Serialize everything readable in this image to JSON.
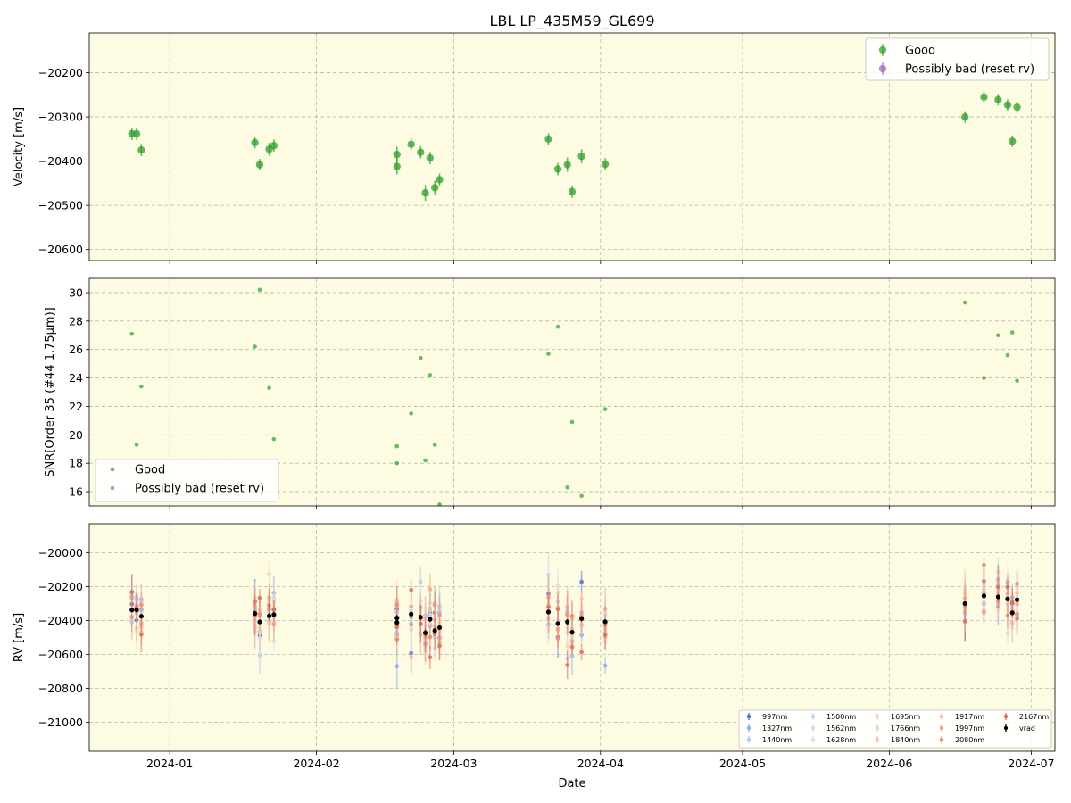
{
  "chart_data": [
    {
      "type": "scatter",
      "panel": "velocity",
      "title": "LBL LP_435M59_GL699",
      "xlabel": "",
      "ylabel": "Velocity [m/s]",
      "ylim": [
        -20625,
        -20110
      ],
      "yticks": [
        -20200,
        -20300,
        -20400,
        -20500,
        -20600
      ],
      "ytick_labels": [
        "−20200",
        "−20300",
        "−20400",
        "−20500",
        "−20600"
      ],
      "grid": true,
      "legend": "top-right",
      "legend_entries": [
        {
          "label": "Good",
          "color": "#2ca02c"
        },
        {
          "label": "Possibly bad (reset rv)",
          "color": "#9467bd"
        }
      ],
      "series": [
        {
          "name": "Good",
          "color": "#2ca02c",
          "x": [
            "2023-12-24",
            "2023-12-25",
            "2023-12-26",
            "2024-01-19",
            "2024-01-20",
            "2024-01-22",
            "2024-01-23",
            "2024-02-18",
            "2024-02-18",
            "2024-02-21",
            "2024-02-23",
            "2024-02-24",
            "2024-02-25",
            "2024-02-26",
            "2024-02-27",
            "2024-03-21",
            "2024-03-23",
            "2024-03-25",
            "2024-03-26",
            "2024-03-28",
            "2024-04-02",
            "2024-06-17",
            "2024-06-21",
            "2024-06-24",
            "2024-06-26",
            "2024-06-27",
            "2024-06-28"
          ],
          "y": [
            -20338,
            -20338,
            -20375,
            -20358,
            -20408,
            -20373,
            -20365,
            -20385,
            -20412,
            -20362,
            -20380,
            -20472,
            -20393,
            -20460,
            -20442,
            -20350,
            -20418,
            -20408,
            -20469,
            -20389,
            -20407,
            -20300,
            -20255,
            -20261,
            -20273,
            -20355,
            -20278
          ],
          "err": [
            14,
            14,
            14,
            13,
            13,
            15,
            14,
            18,
            18,
            14,
            14,
            18,
            14,
            16,
            14,
            13,
            14,
            16,
            14,
            16,
            14,
            13,
            13,
            13,
            13,
            13,
            13
          ]
        },
        {
          "name": "Possibly bad (reset rv)",
          "color": "#9467bd",
          "x": [],
          "y": [],
          "err": []
        }
      ]
    },
    {
      "type": "scatter",
      "panel": "snr",
      "title": "",
      "xlabel": "",
      "ylabel": "SNR[Order 35 (#44 1.75μm)]",
      "ylim": [
        15.0,
        31.0
      ],
      "yticks": [
        16,
        18,
        20,
        22,
        24,
        26,
        28,
        30
      ],
      "ytick_labels": [
        "16",
        "18",
        "20",
        "22",
        "24",
        "26",
        "28",
        "30"
      ],
      "grid": true,
      "legend": "lower-left",
      "legend_entries": [
        {
          "label": "Good",
          "color": "#2ca02c"
        },
        {
          "label": "Possibly bad (reset rv)",
          "color": "#9467bd"
        }
      ],
      "series": [
        {
          "name": "Good",
          "color": "#2ca02c",
          "x": [
            "2023-12-24",
            "2023-12-25",
            "2023-12-26",
            "2024-01-19",
            "2024-01-20",
            "2024-01-22",
            "2024-01-23",
            "2024-02-18",
            "2024-02-18",
            "2024-02-21",
            "2024-02-23",
            "2024-02-24",
            "2024-02-25",
            "2024-02-26",
            "2024-02-27",
            "2024-03-21",
            "2024-03-23",
            "2024-03-25",
            "2024-03-26",
            "2024-03-28",
            "2024-04-02",
            "2024-06-17",
            "2024-06-21",
            "2024-06-24",
            "2024-06-26",
            "2024-06-27",
            "2024-06-28"
          ],
          "y": [
            27.1,
            19.3,
            23.4,
            26.2,
            30.2,
            23.3,
            19.7,
            19.2,
            18.0,
            21.5,
            25.4,
            18.2,
            24.2,
            19.3,
            15.1,
            25.7,
            27.6,
            16.3,
            20.9,
            15.7,
            21.8,
            29.3,
            24.0,
            27.0,
            25.6,
            27.2,
            23.8
          ]
        },
        {
          "name": "Possibly bad (reset rv)",
          "color": "#9467bd",
          "x": [],
          "y": []
        }
      ]
    },
    {
      "type": "scatter",
      "panel": "rv",
      "title": "",
      "xlabel": "Date",
      "ylabel": "RV [m/s]",
      "ylim": [
        -21170,
        -19830
      ],
      "yticks": [
        -20000,
        -20200,
        -20400,
        -20600,
        -20800,
        -21000
      ],
      "ytick_labels": [
        "−20000",
        "−20200",
        "−20400",
        "−20600",
        "−20800",
        "−21000"
      ],
      "xlim": [
        "2023-12-15",
        "2024-07-06"
      ],
      "xticks": [
        "2024-01-01",
        "2024-02-01",
        "2024-03-01",
        "2024-04-01",
        "2024-05-01",
        "2024-06-01",
        "2024-07-01"
      ],
      "xtick_labels": [
        "2024-01",
        "2024-02",
        "2024-03",
        "2024-04",
        "2024-05",
        "2024-06",
        "2024-07"
      ],
      "grid": true,
      "legend": "lower-right",
      "legend_entries": [
        {
          "label": "997nm",
          "color": "#4f6bd3"
        },
        {
          "label": "1327nm",
          "color": "#8caaf5"
        },
        {
          "label": "1440nm",
          "color": "#b2c8f5"
        },
        {
          "label": "1500nm",
          "color": "#c3d4f2"
        },
        {
          "label": "1562nm",
          "color": "#d2dcec"
        },
        {
          "label": "1628nm",
          "color": "#dcdfe6"
        },
        {
          "label": "1695nm",
          "color": "#e6dcd2"
        },
        {
          "label": "1766nm",
          "color": "#efd3c0"
        },
        {
          "label": "1840nm",
          "color": "#f3c7ad"
        },
        {
          "label": "1917nm",
          "color": "#f4b89a"
        },
        {
          "label": "1997nm",
          "color": "#f2a487"
        },
        {
          "label": "2080nm",
          "color": "#ea8b72"
        },
        {
          "label": "2167nm",
          "color": "#dc6a55"
        },
        {
          "label": "vrad",
          "color": "#000000"
        }
      ],
      "series": [
        {
          "name": "vrad",
          "color": "#000000",
          "x": [
            "2023-12-24",
            "2023-12-25",
            "2023-12-26",
            "2024-01-19",
            "2024-01-20",
            "2024-01-22",
            "2024-01-23",
            "2024-02-18",
            "2024-02-18",
            "2024-02-21",
            "2024-02-23",
            "2024-02-24",
            "2024-02-25",
            "2024-02-26",
            "2024-02-27",
            "2024-03-21",
            "2024-03-23",
            "2024-03-25",
            "2024-03-26",
            "2024-03-28",
            "2024-04-02",
            "2024-06-17",
            "2024-06-21",
            "2024-06-24",
            "2024-06-26",
            "2024-06-27",
            "2024-06-28"
          ],
          "y": [
            -20338,
            -20338,
            -20375,
            -20358,
            -20408,
            -20373,
            -20365,
            -20385,
            -20412,
            -20362,
            -20380,
            -20472,
            -20393,
            -20460,
            -20442,
            -20350,
            -20418,
            -20408,
            -20469,
            -20389,
            -20407,
            -20300,
            -20255,
            -20261,
            -20273,
            -20355,
            -20278
          ],
          "err": [
            14,
            14,
            14,
            13,
            13,
            15,
            14,
            18,
            18,
            14,
            14,
            18,
            14,
            16,
            14,
            13,
            14,
            16,
            14,
            16,
            14,
            13,
            13,
            13,
            13,
            13,
            13
          ]
        }
      ]
    }
  ]
}
